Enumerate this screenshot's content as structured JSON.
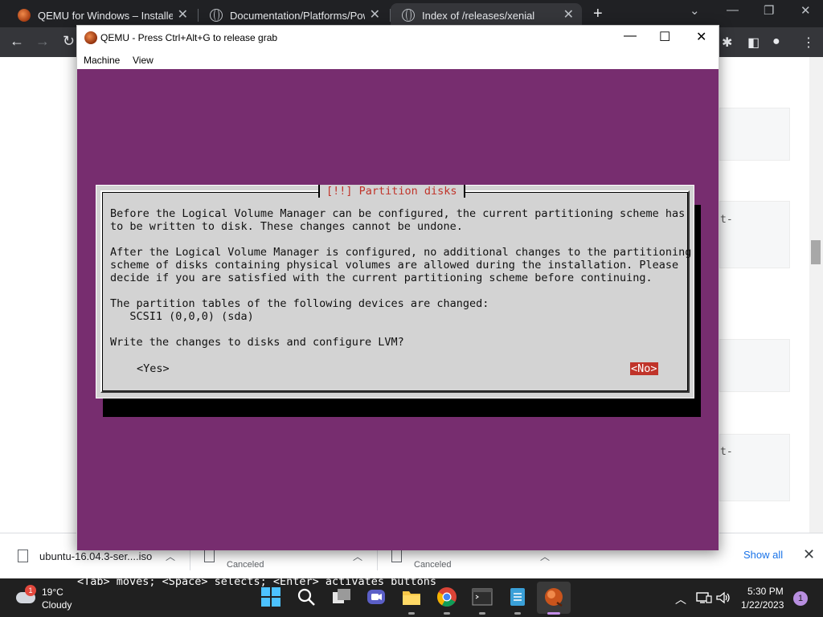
{
  "chrome": {
    "tabs": [
      {
        "title": "QEMU for Windows – Installers (",
        "close": "✕",
        "icon": "qemu-icon"
      },
      {
        "title": "Documentation/Platforms/Power",
        "close": "✕",
        "icon": "globe-icon"
      },
      {
        "title": "Index of /releases/xenial",
        "close": "✕",
        "icon": "globe-icon"
      }
    ],
    "new_tab": "+",
    "page_fragments": [
      "t-",
      "t-"
    ]
  },
  "downloads": {
    "items": [
      {
        "name": "ubuntu-16.04.3-ser....iso",
        "status": ""
      },
      {
        "name": "",
        "status": "Canceled"
      },
      {
        "name": "",
        "status": "Canceled"
      }
    ],
    "show_all": "Show all",
    "close": "✕"
  },
  "qemu": {
    "title": "QEMU - Press Ctrl+Alt+G to release grab",
    "menu": [
      "Machine",
      "View"
    ],
    "dialog": {
      "title": "[!!] Partition disks",
      "lines": [
        "Before the Logical Volume Manager can be configured, the current partitioning scheme has",
        "to be written to disk. These changes cannot be undone.",
        "After the Logical Volume Manager is configured, no additional changes to the partitioning",
        "scheme of disks containing physical volumes are allowed during the installation. Please",
        "decide if you are satisfied with the current partitioning scheme before continuing.",
        "The partition tables of the following devices are changed:",
        "   SCSI1 (0,0,0) (sda)",
        "Write the changes to disks and configure LVM?"
      ],
      "yes": "<Yes>",
      "no": "<No>"
    },
    "status": "<Tab> moves; <Space> selects; <Enter> activates buttons",
    "colors": {
      "background": "#772d6f",
      "dialog": "#d3d3d3",
      "accent": "#c0342a"
    }
  },
  "taskbar": {
    "weather": {
      "temp": "19°C",
      "cond": "Cloudy",
      "badge": "1"
    },
    "clock": {
      "time": "5:30 PM",
      "date": "1/22/2023"
    },
    "notifications": "1"
  }
}
